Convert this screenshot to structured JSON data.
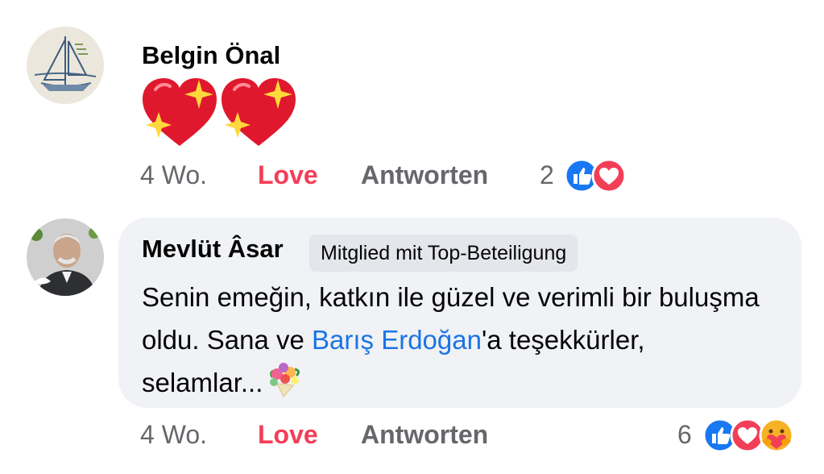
{
  "comments": [
    {
      "author": "Belgin Önal",
      "text": "",
      "timestamp": "4 Wo.",
      "reaction_label": "Love",
      "reply_label": "Antworten",
      "reaction_count": "2",
      "reaction_icons": [
        "like-icon",
        "love-icon"
      ]
    },
    {
      "author": "Mevlüt Âsar",
      "badge": "Mitglied mit Top-Beteiligung",
      "text_part1": "Senin emeğin, katkın ile güzel ve verimli bir buluşma oldu. Sana ve ",
      "mention": "Barış Erdoğan",
      "text_part2": "'a teşekkürler, selamlar...",
      "timestamp": "4 Wo.",
      "reaction_label": "Love",
      "reply_label": "Antworten",
      "reaction_count": "6",
      "reaction_icons": [
        "like-icon",
        "love-icon",
        "care-icon"
      ]
    }
  ],
  "colors": {
    "love": "#f33e58",
    "like": "#1877f2",
    "mention": "#1b74e4",
    "muted": "#65676b",
    "bubble": "#f0f2f5",
    "badge": "#e4e6eb"
  }
}
